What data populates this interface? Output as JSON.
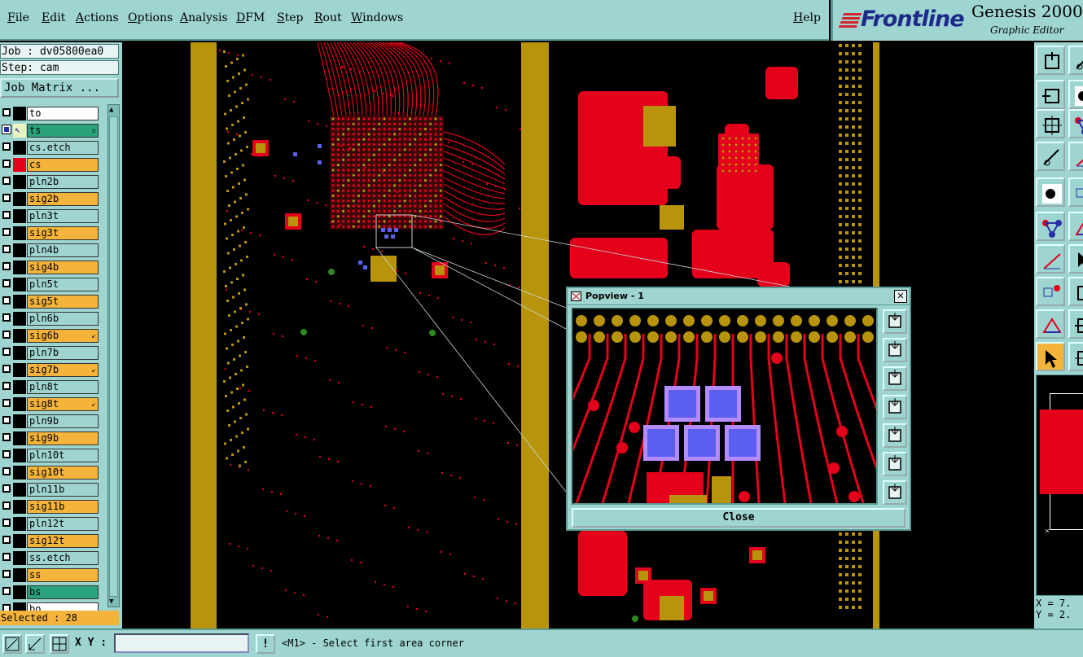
{
  "menubar": {
    "items": [
      "File",
      "Edit",
      "Actions",
      "Options",
      "Analysis",
      "DFM",
      "Step",
      "Rout",
      "Windows"
    ],
    "help": "Help"
  },
  "brand": {
    "logo": "Frontline",
    "title": "Genesis 2000",
    "subtitle": "Graphic Editor"
  },
  "job": {
    "job_text": "Job : dv05800ea0",
    "step_text": "Step: cam",
    "matrix_label": "Job Matrix ..."
  },
  "layers": [
    {
      "name": "to",
      "row_color": "#ffffff",
      "swatch": "#000000",
      "checked": false,
      "mark": ""
    },
    {
      "name": "ts",
      "row_color": "#2aa37d",
      "swatch": "#e8f4c0",
      "checked": true,
      "mark": "▫"
    },
    {
      "name": "cs.etch",
      "row_color": "#9fd5d1",
      "swatch": "#000000",
      "checked": false,
      "mark": ""
    },
    {
      "name": "cs",
      "row_color": "#f4b43c",
      "swatch": "#e4001b",
      "checked": false,
      "mark": ""
    },
    {
      "name": "pln2b",
      "row_color": "#9fd5d1",
      "swatch": "#000000",
      "checked": false,
      "mark": ""
    },
    {
      "name": "sig2b",
      "row_color": "#f4b43c",
      "swatch": "#000000",
      "checked": false,
      "mark": ""
    },
    {
      "name": "pln3t",
      "row_color": "#9fd5d1",
      "swatch": "#000000",
      "checked": false,
      "mark": ""
    },
    {
      "name": "sig3t",
      "row_color": "#f4b43c",
      "swatch": "#000000",
      "checked": false,
      "mark": ""
    },
    {
      "name": "pln4b",
      "row_color": "#9fd5d1",
      "swatch": "#000000",
      "checked": false,
      "mark": ""
    },
    {
      "name": "sig4b",
      "row_color": "#f4b43c",
      "swatch": "#000000",
      "checked": false,
      "mark": ""
    },
    {
      "name": "pln5t",
      "row_color": "#9fd5d1",
      "swatch": "#000000",
      "checked": false,
      "mark": ""
    },
    {
      "name": "sig5t",
      "row_color": "#f4b43c",
      "swatch": "#000000",
      "checked": false,
      "mark": ""
    },
    {
      "name": "pln6b",
      "row_color": "#9fd5d1",
      "swatch": "#000000",
      "checked": false,
      "mark": ""
    },
    {
      "name": "sig6b",
      "row_color": "#f4b43c",
      "swatch": "#000000",
      "checked": false,
      "mark": "⇙"
    },
    {
      "name": "pln7b",
      "row_color": "#9fd5d1",
      "swatch": "#000000",
      "checked": false,
      "mark": ""
    },
    {
      "name": "sig7b",
      "row_color": "#f4b43c",
      "swatch": "#000000",
      "checked": false,
      "mark": "⇙"
    },
    {
      "name": "pln8t",
      "row_color": "#9fd5d1",
      "swatch": "#000000",
      "checked": false,
      "mark": ""
    },
    {
      "name": "sig8t",
      "row_color": "#f4b43c",
      "swatch": "#000000",
      "checked": false,
      "mark": "⇙"
    },
    {
      "name": "pln9b",
      "row_color": "#9fd5d1",
      "swatch": "#000000",
      "checked": false,
      "mark": ""
    },
    {
      "name": "sig9b",
      "row_color": "#f4b43c",
      "swatch": "#000000",
      "checked": false,
      "mark": ""
    },
    {
      "name": "pln10t",
      "row_color": "#9fd5d1",
      "swatch": "#000000",
      "checked": false,
      "mark": ""
    },
    {
      "name": "sig10t",
      "row_color": "#f4b43c",
      "swatch": "#000000",
      "checked": false,
      "mark": ""
    },
    {
      "name": "pln11b",
      "row_color": "#9fd5d1",
      "swatch": "#000000",
      "checked": false,
      "mark": ""
    },
    {
      "name": "sig11b",
      "row_color": "#f4b43c",
      "swatch": "#000000",
      "checked": false,
      "mark": ""
    },
    {
      "name": "pln12t",
      "row_color": "#9fd5d1",
      "swatch": "#000000",
      "checked": false,
      "mark": ""
    },
    {
      "name": "sig12t",
      "row_color": "#f4b43c",
      "swatch": "#000000",
      "checked": false,
      "mark": ""
    },
    {
      "name": "ss.etch",
      "row_color": "#9fd5d1",
      "swatch": "#000000",
      "checked": false,
      "mark": ""
    },
    {
      "name": "ss",
      "row_color": "#f4b43c",
      "swatch": "#000000",
      "checked": false,
      "mark": ""
    },
    {
      "name": "bs",
      "row_color": "#2aa37d",
      "swatch": "#000000",
      "checked": false,
      "mark": ""
    },
    {
      "name": "bo",
      "row_color": "#ffffff",
      "swatch": "#000000",
      "checked": false,
      "mark": ""
    }
  ],
  "selected_text": "Selected : 28",
  "popview": {
    "title": "Popview - 1",
    "close_x": "✕",
    "close_label": "Close"
  },
  "coords": {
    "x_text": "X = 7.",
    "y_text": "Y = 2."
  },
  "bottombar": {
    "xy_label": "X Y :",
    "xy_value": "",
    "message": "<M1> - Select first area corner",
    "excl": "!"
  },
  "colors": {
    "panel": "#9fd5d1",
    "copper": "#e4001b",
    "gold": "#b8940c",
    "selection": "#5a5ff0",
    "layer_orange": "#f4b43c",
    "layer_green": "#2aa37d"
  }
}
